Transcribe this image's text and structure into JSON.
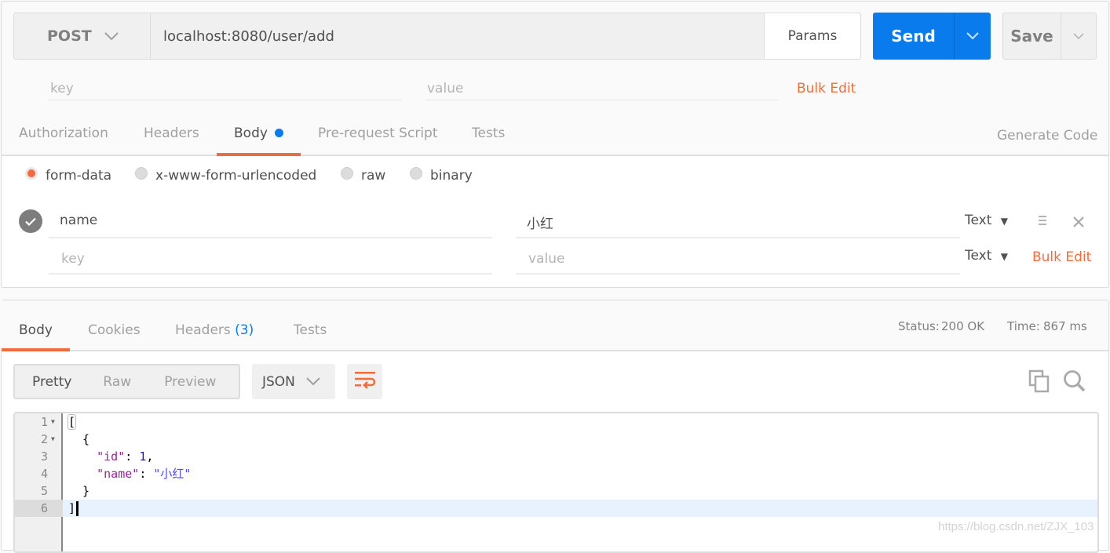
{
  "request": {
    "method": "POST",
    "url": "localhost:8080/user/add",
    "params_label": "Params",
    "send_label": "Send",
    "save_label": "Save",
    "query_params": {
      "key_placeholder": "key",
      "value_placeholder": "value",
      "bulk_edit_label": "Bulk Edit"
    },
    "tabs": [
      {
        "label": "Authorization",
        "active": false
      },
      {
        "label": "Headers",
        "active": false
      },
      {
        "label": "Body",
        "active": true,
        "has_dot": true
      },
      {
        "label": "Pre-request Script",
        "active": false
      },
      {
        "label": "Tests",
        "active": false
      }
    ],
    "generate_code_label": "Generate Code",
    "body_types": [
      {
        "label": "form-data",
        "selected": true
      },
      {
        "label": "x-www-form-urlencoded",
        "selected": false
      },
      {
        "label": "raw",
        "selected": false
      },
      {
        "label": "binary",
        "selected": false
      }
    ],
    "form_rows": [
      {
        "checked": true,
        "key": "name",
        "value": "小红",
        "type": "Text"
      },
      {
        "key_placeholder": "key",
        "value_placeholder": "value",
        "type": "Text"
      }
    ],
    "form_bulk_edit_label": "Bulk Edit"
  },
  "response": {
    "tabs": [
      {
        "label": "Body",
        "active": true
      },
      {
        "label": "Cookies",
        "active": false
      },
      {
        "label": "Headers",
        "count": "(3)",
        "active": false
      },
      {
        "label": "Tests",
        "active": false
      }
    ],
    "status_label": "Status:",
    "status_value": "200 OK",
    "time_label": "Time:",
    "time_value": "867 ms",
    "view_modes": [
      {
        "label": "Pretty",
        "active": true
      },
      {
        "label": "Raw",
        "active": false
      },
      {
        "label": "Preview",
        "active": false
      }
    ],
    "format": "JSON",
    "code_lines": [
      {
        "n": "1",
        "fold": true
      },
      {
        "n": "2",
        "fold": true
      },
      {
        "n": "3",
        "fold": false
      },
      {
        "n": "4",
        "fold": false
      },
      {
        "n": "5",
        "fold": false
      },
      {
        "n": "6",
        "fold": false
      }
    ],
    "code": {
      "l1": "[",
      "l2": "  {",
      "l3_key": "\"id\"",
      "l3_sep": ": ",
      "l3_val": "1",
      "l3_end": ",",
      "l4_key": "\"name\"",
      "l4_sep": ": ",
      "l4_val": "\"小红\"",
      "l5": "  }",
      "l6": "]"
    }
  },
  "watermark": "https://blog.csdn.net/ZJX_103",
  "colors": {
    "accent_orange": "#f26b3a",
    "send_blue": "#097bed",
    "link_blue": "#097bed"
  }
}
